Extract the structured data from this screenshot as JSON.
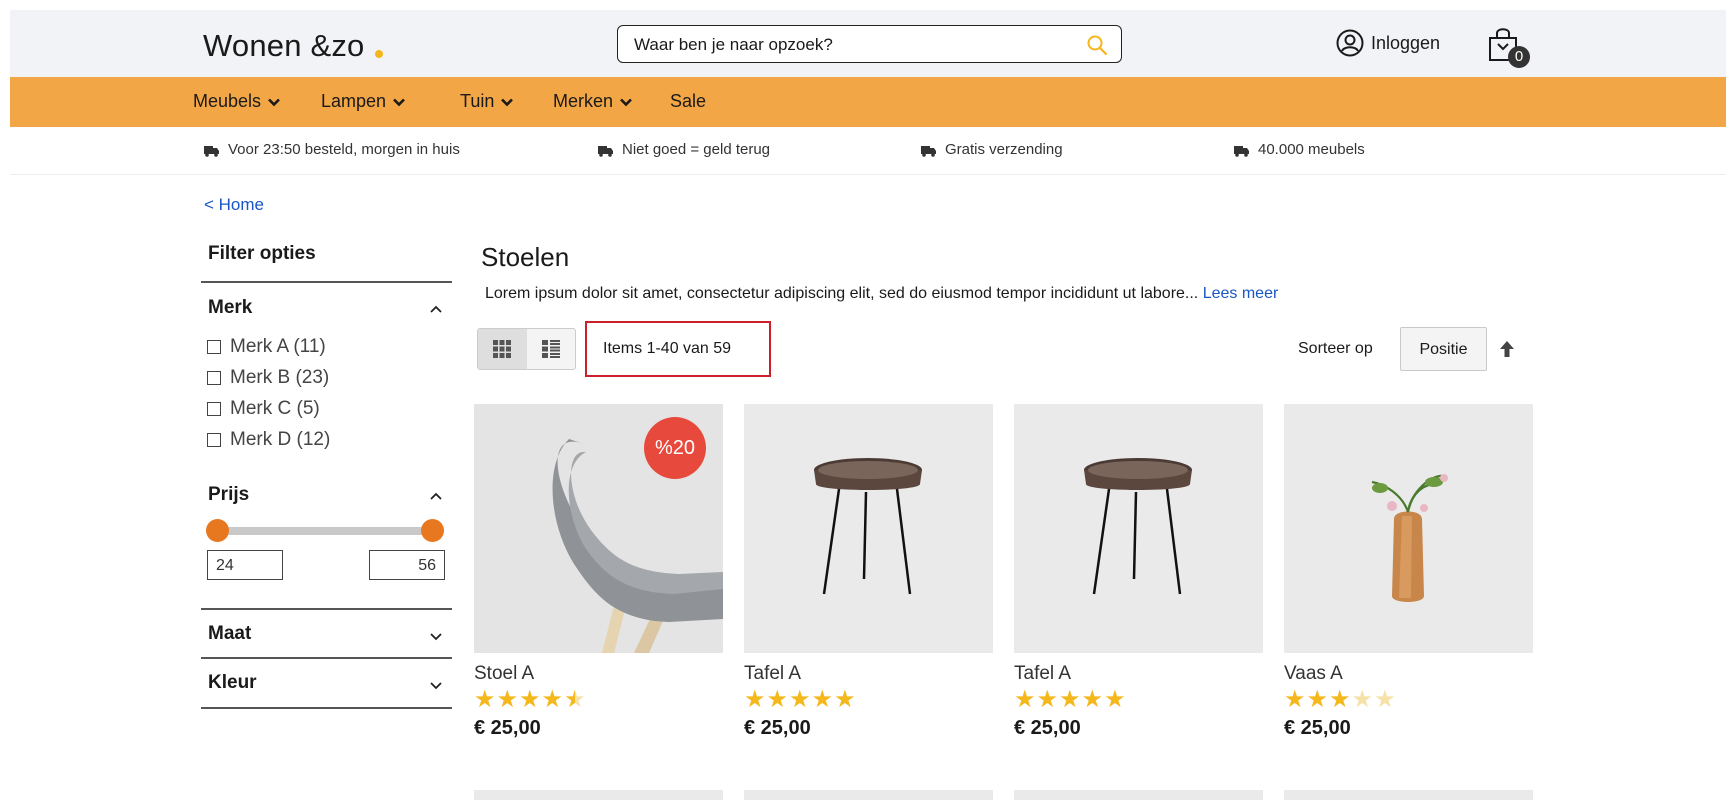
{
  "colors": {
    "accent": "#f2a646",
    "accent_dot": "#f5b61a",
    "link": "#1a56c5",
    "highlight": "#cc1f2c",
    "badge": "#e74a3c",
    "star_on": "#f5b81c",
    "star_off": "#f6e1a8",
    "knob": "#e8781f"
  },
  "header": {
    "logo": "Wonen &zo",
    "search": {
      "placeholder": "Waar ben je naar opzoek?",
      "icon": "search-icon"
    },
    "login_label": "Inloggen",
    "cart_count": "0"
  },
  "nav": {
    "items": [
      {
        "label": "Meubels",
        "dropdown": true
      },
      {
        "label": "Lampen",
        "dropdown": true
      },
      {
        "label": "Tuin",
        "dropdown": true
      },
      {
        "label": "Merken",
        "dropdown": true
      },
      {
        "label": "Sale",
        "dropdown": false
      }
    ]
  },
  "usps": [
    "Voor 23:50 besteld, morgen in huis",
    "Niet goed = geld terug",
    "Gratis verzending",
    "40.000 meubels"
  ],
  "breadcrumb": "< Home",
  "filters": {
    "title": "Filter opties",
    "merk": {
      "label": "Merk",
      "options": [
        "Merk A (11)",
        "Merk B (23)",
        "Merk C (5)",
        "Merk D (12)"
      ]
    },
    "prijs": {
      "label": "Prijs",
      "min": "24",
      "max": "56"
    },
    "maat": {
      "label": "Maat"
    },
    "kleur": {
      "label": "Kleur"
    }
  },
  "main": {
    "title": "Stoelen",
    "intro": "Lorem ipsum dolor sit amet, consectetur adipiscing elit, sed do eiusmod tempor incididunt ut labore...",
    "read_more": "Lees meer",
    "item_count": "Items 1-40 van 59",
    "sort_label": "Sorteer op",
    "sort_value": "Positie"
  },
  "products": [
    {
      "name": "Stoel A",
      "rating": 4.5,
      "price": "€ 25,00",
      "badge": "%20",
      "image": "chair"
    },
    {
      "name": "Tafel A",
      "rating": 5,
      "price": "€ 25,00",
      "badge": "",
      "image": "table"
    },
    {
      "name": "Tafel A",
      "rating": 5,
      "price": "€ 25,00",
      "badge": "",
      "image": "table"
    },
    {
      "name": "Vaas A",
      "rating": 3,
      "price": "€ 25,00",
      "badge": "",
      "image": "vase"
    }
  ]
}
